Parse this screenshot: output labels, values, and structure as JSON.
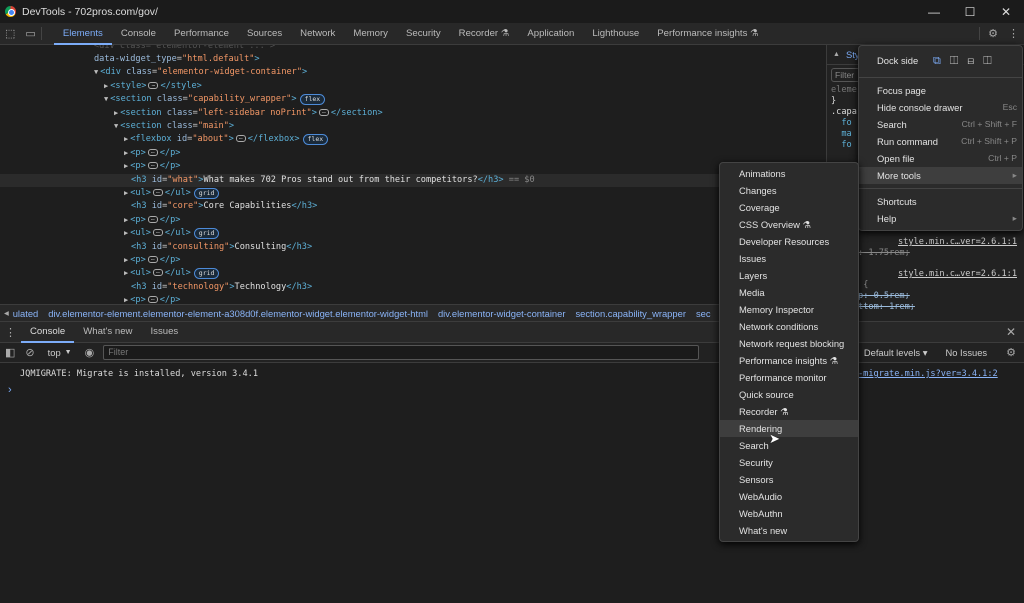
{
  "window": {
    "title": "DevTools - 702pros.com/gov/",
    "controls": [
      "—",
      "☐",
      "✕"
    ]
  },
  "tabs": [
    "Elements",
    "Console",
    "Performance",
    "Sources",
    "Network",
    "Memory",
    "Security",
    "Recorder ⚗",
    "Application",
    "Lighthouse",
    "Performance insights ⚗"
  ],
  "elements": {
    "lines": [
      {
        "indent": 94,
        "html": "<span class='attr'>data-widget_type</span>=<span class='val'>\"html.default\"</span><span class='tag'>&gt;</span>"
      },
      {
        "indent": 94,
        "html": "<span class='arrow'>▼</span><span class='tag'>&lt;div </span><span class='attr'>class</span>=<span class='val'>\"elementor-widget-container\"</span><span class='tag'>&gt;</span>"
      },
      {
        "indent": 104,
        "html": "<span class='arrow'>▶</span><span class='tag'>&lt;style&gt;</span><span class='ell'>…</span><span class='tag'>&lt;/style&gt;</span>"
      },
      {
        "indent": 104,
        "html": "<span class='arrow'>▼</span><span class='tag'>&lt;section </span><span class='attr'>class</span>=<span class='val'>\"capability_wrapper\"</span><span class='tag'>&gt;</span><span class='badge'>flex</span>"
      },
      {
        "indent": 114,
        "html": "<span class='arrow'>▶</span><span class='tag'>&lt;section </span><span class='attr'>class</span>=<span class='val'>\"left-sidebar noPrint\"</span><span class='tag'>&gt;</span><span class='ell'>…</span><span class='tag'>&lt;/section&gt;</span>"
      },
      {
        "indent": 114,
        "html": "<span class='arrow'>▼</span><span class='tag'>&lt;section </span><span class='attr'>class</span>=<span class='val'>\"main\"</span><span class='tag'>&gt;</span>"
      },
      {
        "indent": 124,
        "html": "<span class='arrow'>▶</span><span class='tag'>&lt;flexbox </span><span class='attr'>id</span>=<span class='val'>\"about\"</span><span class='tag'>&gt;</span><span class='ell'>…</span><span class='tag'>&lt;/flexbox&gt;</span><span class='badge'>flex</span>"
      },
      {
        "indent": 124,
        "html": "<span class='arrow'>▶</span><span class='tag'>&lt;p&gt;</span><span class='ell'>…</span><span class='tag'>&lt;/p&gt;</span>"
      },
      {
        "indent": 124,
        "html": "<span class='arrow'>▶</span><span class='tag'>&lt;p&gt;</span><span class='ell'>…</span><span class='tag'>&lt;/p&gt;</span>"
      },
      {
        "indent": 131,
        "sel": true,
        "html": "<span class='tag'>&lt;h3 </span><span class='attr'>id</span>=<span class='val'>\"what\"</span><span class='tag'>&gt;</span><span class='txt'>What makes 702 Pros stand out from their competitors?</span><span class='tag'>&lt;/h3&gt;</span> <span style='color:#888'>== $0</span>"
      },
      {
        "indent": 124,
        "html": "<span class='arrow'>▶</span><span class='tag'>&lt;ul&gt;</span><span class='ell'>…</span><span class='tag'>&lt;/ul&gt;</span><span class='badge'>grid</span>"
      },
      {
        "indent": 131,
        "html": "<span class='tag'>&lt;h3 </span><span class='attr'>id</span>=<span class='val'>\"core\"</span><span class='tag'>&gt;</span><span class='txt'>Core Capabilities</span><span class='tag'>&lt;/h3&gt;</span>"
      },
      {
        "indent": 124,
        "html": "<span class='arrow'>▶</span><span class='tag'>&lt;p&gt;</span><span class='ell'>…</span><span class='tag'>&lt;/p&gt;</span>"
      },
      {
        "indent": 124,
        "html": "<span class='arrow'>▶</span><span class='tag'>&lt;ul&gt;</span><span class='ell'>…</span><span class='tag'>&lt;/ul&gt;</span><span class='badge'>grid</span>"
      },
      {
        "indent": 131,
        "html": "<span class='tag'>&lt;h3 </span><span class='attr'>id</span>=<span class='val'>\"consulting\"</span><span class='tag'>&gt;</span><span class='txt'>Consulting</span><span class='tag'>&lt;/h3&gt;</span>"
      },
      {
        "indent": 124,
        "html": "<span class='arrow'>▶</span><span class='tag'>&lt;p&gt;</span><span class='ell'>…</span><span class='tag'>&lt;/p&gt;</span>"
      },
      {
        "indent": 124,
        "html": "<span class='arrow'>▶</span><span class='tag'>&lt;ul&gt;</span><span class='ell'>…</span><span class='tag'>&lt;/ul&gt;</span><span class='badge'>grid</span>"
      },
      {
        "indent": 131,
        "html": "<span class='tag'>&lt;h3 </span><span class='attr'>id</span>=<span class='val'>\"technology\"</span><span class='tag'>&gt;</span><span class='txt'>Technology</span><span class='tag'>&lt;/h3&gt;</span>"
      },
      {
        "indent": 124,
        "html": "<span class='arrow'>▶</span><span class='tag'>&lt;p&gt;</span><span class='ell'>…</span><span class='tag'>&lt;/p&gt;</span>"
      }
    ]
  },
  "breadcrumb": [
    "ulated",
    "div.elementor-element.elementor-element-a308d0f.elementor-widget.elementor-widget-html",
    "div.elementor-widget-container",
    "section.capability_wrapper",
    "sec"
  ],
  "styles": {
    "tab": "Styles",
    "filter": "Filter",
    "lines": [
      "eleme",
      "}",
      ".capa",
      "  fo",
      "  ma",
      "  fo"
    ],
    "rule1_source": "style.min.c…ver=2.6.1:1",
    "rule1_prop": "t-size: 1.75rem;",
    "rule2_source": "style.min.c…ver=2.6.1:1",
    "rule2_sel": "h5, h6 {",
    "rule2_p1": "gin-top: 0.5rem;",
    "rule2_p2": "gin-bottom: 1rem;"
  },
  "drawer": {
    "tabs": [
      "Console",
      "What's new",
      "Issues"
    ]
  },
  "console_toolbar": {
    "context": "top",
    "filter_placeholder": "Filter",
    "levels": "Default levels ▾",
    "issues": "No Issues"
  },
  "console": {
    "messages": [
      "JQMIGRATE: Migrate is installed, version 3.4.1"
    ],
    "source": "-migrate.min.js?ver=3.4.1:2",
    "prompt": "›"
  },
  "main_menu": {
    "dock_side_label": "Dock side",
    "items": [
      {
        "label": "Focus page",
        "shortcut": ""
      },
      {
        "label": "Hide console drawer",
        "shortcut": "Esc"
      },
      {
        "label": "Search",
        "shortcut": "Ctrl + Shift + F"
      },
      {
        "label": "Run command",
        "shortcut": "Ctrl + Shift + P"
      },
      {
        "label": "Open file",
        "shortcut": "Ctrl + P"
      },
      {
        "label": "More tools",
        "shortcut": "▸",
        "highlighted": true
      }
    ],
    "items2": [
      {
        "label": "Shortcuts",
        "shortcut": ""
      },
      {
        "label": "Help",
        "shortcut": "▸"
      }
    ]
  },
  "more_tools": {
    "items": [
      "Animations",
      "Changes",
      "Coverage",
      "CSS Overview ⚗",
      "Developer Resources",
      "Issues",
      "Layers",
      "Media",
      "Memory Inspector",
      "Network conditions",
      "Network request blocking",
      "Performance insights ⚗",
      "Performance monitor",
      "Quick source",
      "Recorder ⚗",
      "Rendering",
      "Search",
      "Security",
      "Sensors",
      "WebAudio",
      "WebAuthn",
      "What's new"
    ],
    "highlighted": "Rendering"
  },
  "colors": {
    "accent": "#7cacf8",
    "tag": "#5db0d7",
    "attr_value": "#f29766"
  }
}
